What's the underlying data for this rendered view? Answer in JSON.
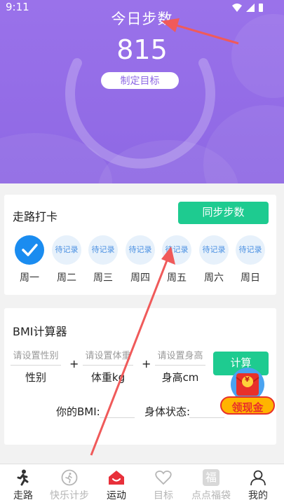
{
  "status_bar": {
    "time": "9:11"
  },
  "header": {
    "title": "今日步数",
    "step_count": "815",
    "goal_button": "制定目标"
  },
  "checkin": {
    "title": "走路打卡",
    "sync_button": "同步步数",
    "days": [
      {
        "label": "周一",
        "status": "",
        "done": true
      },
      {
        "label": "周二",
        "status": "待记录",
        "done": false
      },
      {
        "label": "周三",
        "status": "待记录",
        "done": false
      },
      {
        "label": "周四",
        "status": "待记录",
        "done": false
      },
      {
        "label": "周五",
        "status": "待记录",
        "done": false
      },
      {
        "label": "周六",
        "status": "待记录",
        "done": false
      },
      {
        "label": "周日",
        "status": "待记录",
        "done": false
      }
    ]
  },
  "bmi": {
    "title": "BMI计算器",
    "gender_placeholder": "请设置性别",
    "gender_label": "性别",
    "weight_placeholder": "请设置体重",
    "weight_label": "体重kg",
    "height_placeholder": "请设置身高",
    "height_label": "身高cm",
    "plus": "+",
    "calc_button": "计算",
    "result_bmi_label": "你的BMI:",
    "result_status_label": "身体状态:"
  },
  "floating": {
    "badge_text": "领现金",
    "coin_symbol": "¥"
  },
  "bottom_nav": {
    "items": [
      {
        "label": "走路",
        "icon": "walker-icon"
      },
      {
        "label": "快乐计步",
        "icon": "running-circle-icon"
      },
      {
        "label": "运动",
        "icon": "home-sport-icon"
      },
      {
        "label": "目标",
        "icon": "heart-icon"
      },
      {
        "label": "点点福袋",
        "icon": "fortune-bag-icon",
        "icon_text": "福"
      },
      {
        "label": "我的",
        "icon": "user-icon"
      }
    ],
    "active_index": 2
  },
  "colors": {
    "header_purple": "#8e68e4",
    "green": "#1ecb90",
    "blue": "#1a8cf0",
    "annotation_red": "#f05a5a"
  }
}
